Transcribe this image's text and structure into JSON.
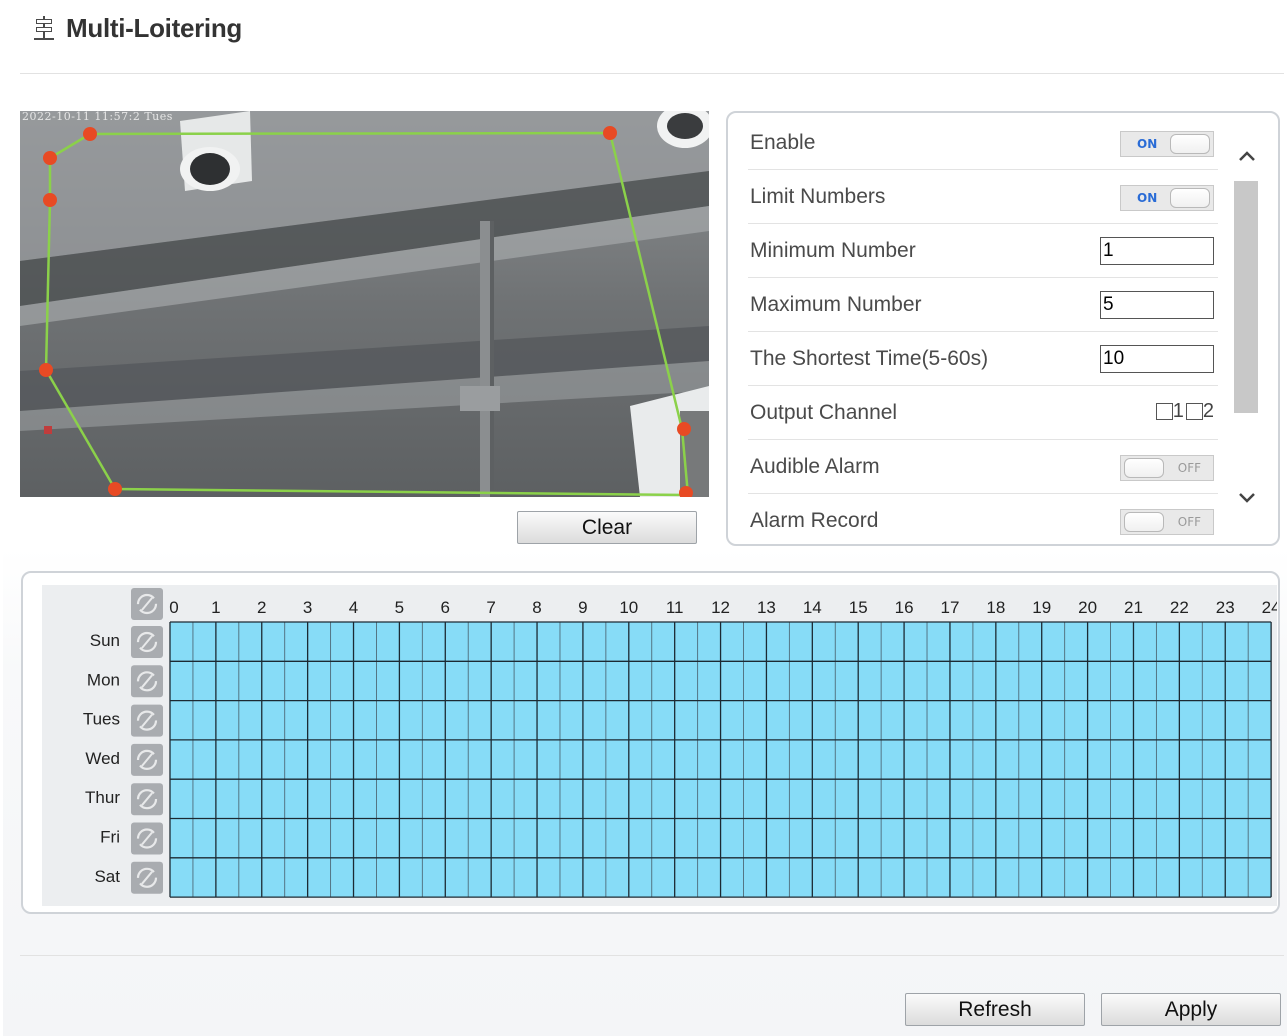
{
  "page": {
    "title": "Multi-Loitering",
    "title_icon": "signpost-icon"
  },
  "video": {
    "osd_text": "2022-10-11 11:57:2  Tues"
  },
  "buttons": {
    "clear": "Clear",
    "refresh": "Refresh",
    "apply": "Apply"
  },
  "settings": {
    "enable": {
      "label": "Enable",
      "state": "ON"
    },
    "limit_numbers": {
      "label": "Limit Numbers",
      "state": "ON"
    },
    "minimum_number": {
      "label": "Minimum Number",
      "value": "1"
    },
    "maximum_number": {
      "label": "Maximum Number",
      "value": "5"
    },
    "shortest_time": {
      "label": "The Shortest Time(5-60s)",
      "value": "10"
    },
    "output_channel": {
      "label": "Output Channel",
      "channels": [
        "1",
        "2"
      ]
    },
    "audible_alarm": {
      "label": "Audible Alarm",
      "state": "OFF"
    },
    "alarm_record": {
      "label": "Alarm Record",
      "state": "OFF"
    }
  },
  "schedule": {
    "days": [
      "Sun",
      "Mon",
      "Tues",
      "Wed",
      "Thur",
      "Fri",
      "Sat"
    ],
    "hours": [
      "0",
      "1",
      "2",
      "3",
      "4",
      "5",
      "6",
      "7",
      "8",
      "9",
      "10",
      "11",
      "12",
      "13",
      "14",
      "15",
      "16",
      "17",
      "18",
      "19",
      "20",
      "21",
      "22",
      "23",
      "24"
    ],
    "selected_color": "#87dcf7",
    "all_selected": true
  },
  "colors": {
    "region_line": "#8bd14a",
    "region_point": "#e84a24",
    "toggle_on_text": "#2a6cd6"
  }
}
